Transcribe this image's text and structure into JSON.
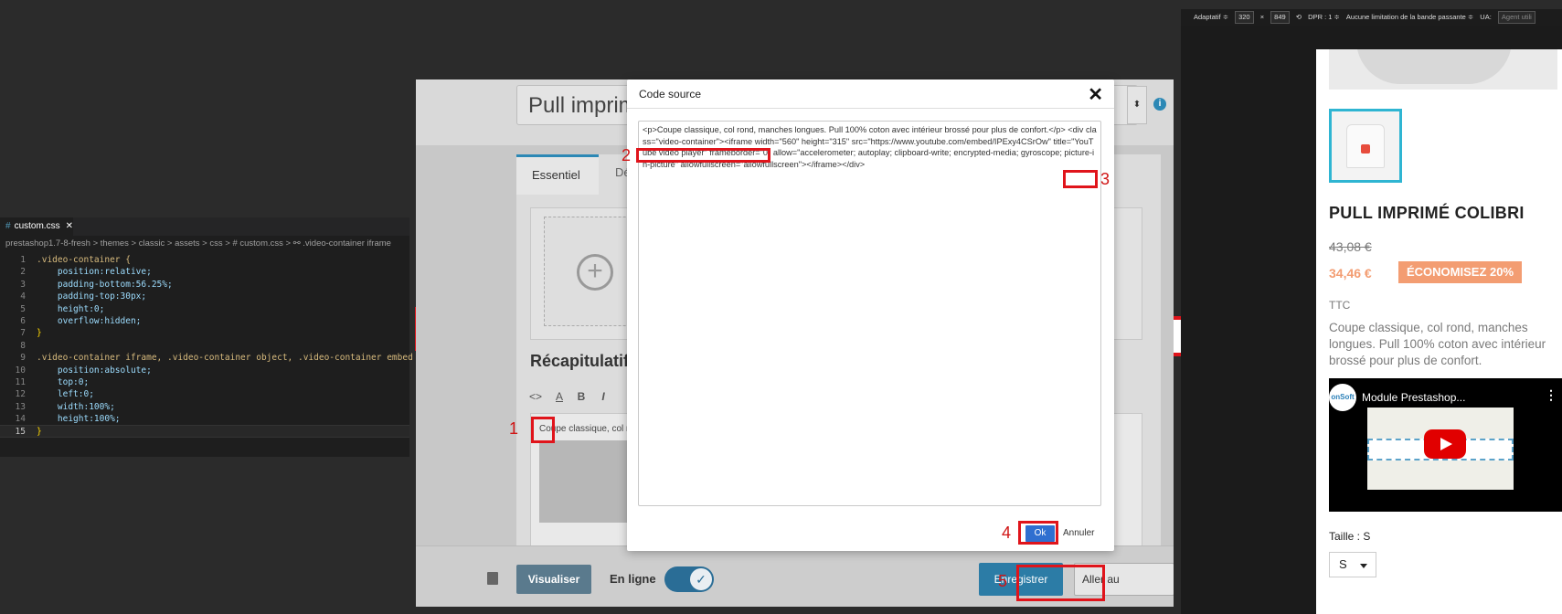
{
  "editor": {
    "tab_label": "custom.css",
    "breadcrumb": "prestashop1.7-8-fresh  >  themes  >  classic  >  assets  >  css  >  #  custom.css  >  ⚯ .video-container iframe",
    "lines": [
      {
        "n": "1",
        "t": ".video-container {"
      },
      {
        "n": "2",
        "t": "    position:relative;"
      },
      {
        "n": "3",
        "t": "    padding-bottom:56.25%;"
      },
      {
        "n": "4",
        "t": "    padding-top:30px;"
      },
      {
        "n": "5",
        "t": "    height:0;"
      },
      {
        "n": "6",
        "t": "    overflow:hidden;"
      },
      {
        "n": "7",
        "t": "}"
      },
      {
        "n": "8",
        "t": ""
      },
      {
        "n": "9",
        "t": ".video-container iframe, .video-container object, .video-container embed {"
      },
      {
        "n": "10",
        "t": "    position:absolute;"
      },
      {
        "n": "11",
        "t": "    top:0;"
      },
      {
        "n": "12",
        "t": "    left:0;"
      },
      {
        "n": "13",
        "t": "    width:100%;"
      },
      {
        "n": "14",
        "t": "    height:100%;"
      },
      {
        "n": "15",
        "t": "}"
      }
    ]
  },
  "backoffice": {
    "product_name": "Pull imprim",
    "tab_essentials": "Essentiel",
    "tab_declinaisons": "Décl",
    "summary_title": "Récapitulatif",
    "summary_text": "Coupe classique, col r",
    "btn_preview": "Visualiser",
    "online_label": "En ligne",
    "btn_save": "Enregistrer",
    "btn_goto": "Aller au"
  },
  "modal": {
    "title": "Code source",
    "close": "✕",
    "code_part1": "<p>Coupe classique, col rond, manches longues. Pull 100% coton avec intérieur brossé pour plus de confort.</p> ",
    "code_div_open": "<div class=\"video-container\">",
    "code_part2": "<iframe width=\"560\" height=\"315\" src=\"https://www.youtube.com/embed/IPExy4CSrOw\" title=\"YouTube video player\" frameborder=\"0\" allow=\"accelerometer; autoplay; clipboard-write; encrypted-media; gyroscope; picture-in-picture\" allowfullscreen=\"allowfullscreen\"></iframe>",
    "code_div_close": "</div>",
    "ok": "Ok",
    "cancel": "Annuler"
  },
  "markers": [
    "1",
    "2",
    "3",
    "4",
    "5"
  ],
  "devtools": {
    "mode": "Adaptatif ≑",
    "width": "320",
    "times": "×",
    "height": "849",
    "dpr": "DPR : 1 ≑",
    "throttle": "Aucune limitation de la bande passante ≑",
    "ua": "UA:",
    "ua_placeholder": "Agent utili"
  },
  "mobile": {
    "product_title": "PULL IMPRIMÉ COLIBRI",
    "old_price": "43,08 €",
    "new_price": "34,46 €",
    "discount": "ÉCONOMISEZ 20%",
    "tax": "TTC",
    "description": "Coupe classique, col rond, manches longues. Pull 100% coton avec intérieur brossé pour plus de confort.",
    "video_channel": "onSoft",
    "video_title": "Module Prestashop...",
    "video_more": "⋮",
    "video_banner": "20%",
    "size_label": "Taille : S",
    "size_value": "S"
  },
  "colors": {
    "accent_red": "#e0141b",
    "prestashop_blue": "#2c88b5",
    "discount_orange": "#f39d72",
    "thumb_border": "#2fb5d2"
  }
}
